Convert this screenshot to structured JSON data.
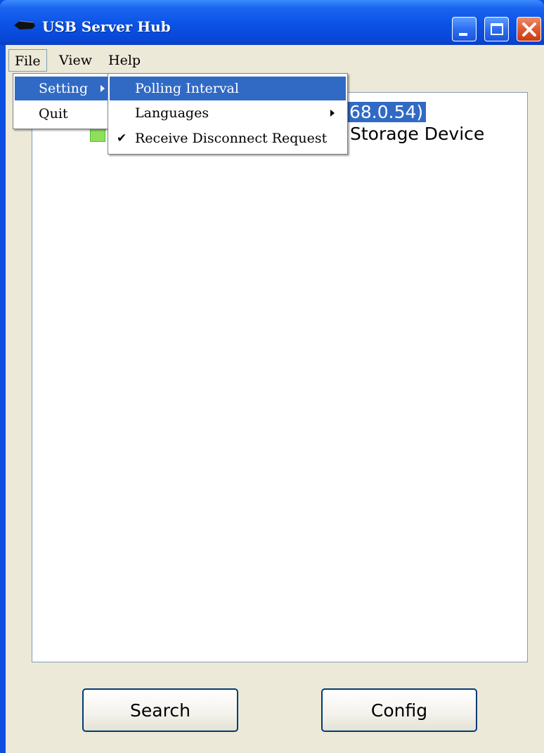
{
  "window": {
    "title": "USB Server Hub",
    "app_icon": "usb-cable-icon"
  },
  "title_buttons": {
    "minimize_icon": "minimize-icon",
    "maximize_icon": "maximize-icon",
    "close_icon": "close-icon"
  },
  "menubar": {
    "items": [
      {
        "label": "File"
      },
      {
        "label": "View"
      },
      {
        "label": "Help"
      }
    ]
  },
  "file_menu": {
    "items": [
      {
        "label": "Setting",
        "has_submenu": true
      },
      {
        "label": "Quit"
      }
    ]
  },
  "setting_menu": {
    "items": [
      {
        "label": "Polling Interval",
        "highlighted": true
      },
      {
        "label": "Languages",
        "has_submenu": true
      },
      {
        "label": "Receive Disconnect Request",
        "checked": true,
        "check_mark": "✔"
      }
    ]
  },
  "tree": {
    "server_suffix": "68.0.54)",
    "device_suffix": "Storage Device",
    "device_icon": "usb-device-icon"
  },
  "buttons": {
    "search_label": "Search",
    "config_label": "Config"
  },
  "colors": {
    "title_bar": "#0a52e6",
    "menu_highlight": "#316ac5",
    "client_bg": "#ece9d8",
    "close_button": "#e05a32"
  }
}
